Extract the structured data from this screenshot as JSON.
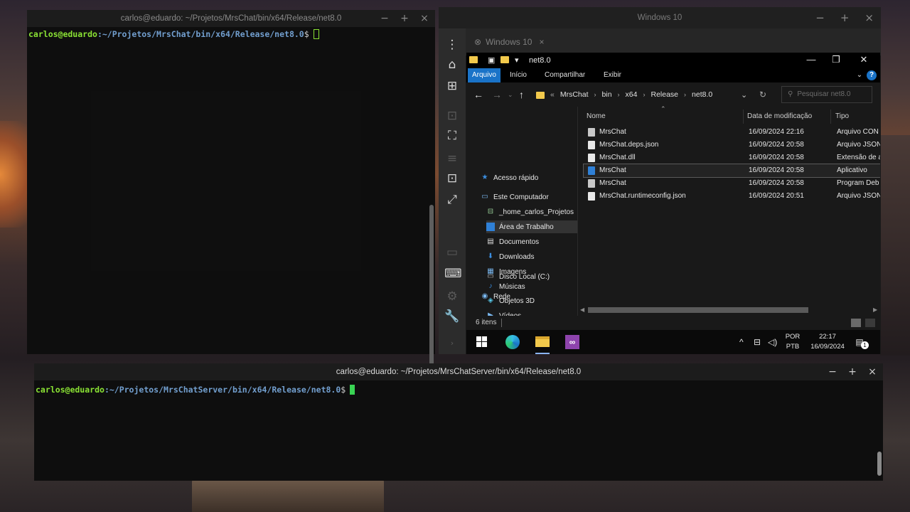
{
  "terminal_top": {
    "title": "carlos@eduardo: ~/Projetos/MrsChat/bin/x64/Release/net8.0",
    "prompt_user": "carlos@eduardo",
    "prompt_path": ":~/Projetos/MrsChat/bin/x64/Release/net8.0",
    "prompt_symbol": "$"
  },
  "terminal_bottom": {
    "title": "carlos@eduardo: ~/Projetos/MrsChatServer/bin/x64/Release/net8.0",
    "prompt_user": "carlos@eduardo",
    "prompt_path": ":~/Projetos/MrsChatServer/bin/x64/Release/net8.0",
    "prompt_symbol": "$"
  },
  "window_controls": {
    "minimize": "−",
    "maximize": "+",
    "close": "×"
  },
  "vm": {
    "title": "Windows 10",
    "tab_label": "Windows 10",
    "tab_close": "×",
    "controls": {
      "minimize": "−",
      "maximize": "+",
      "close": "×"
    }
  },
  "explorer": {
    "window_title": "net8.0",
    "controls": {
      "minimize": "—",
      "restore": "❐",
      "close": "✕"
    },
    "ribbon_tabs": [
      "Arquivo",
      "Início",
      "Compartilhar",
      "Exibir"
    ],
    "breadcrumb": [
      "MrsChat",
      "bin",
      "x64",
      "Release",
      "net8.0"
    ],
    "breadcrumb_prefix": "«",
    "search_placeholder": "Pesquisar net8.0",
    "nav": {
      "quick_access": "Acesso rápido",
      "this_pc": "Este Computador",
      "items": [
        "_home_carlos_Projetos",
        "Área de Trabalho",
        "Documentos",
        "Downloads",
        "Imagens",
        "Músicas",
        "Objetos 3D",
        "Vídeos",
        "Disco Local (C:)"
      ],
      "network": "Rede"
    },
    "columns": {
      "name": "Nome",
      "date": "Data de modificação",
      "type": "Tipo"
    },
    "files": [
      {
        "name": "MrsChat",
        "date": "16/09/2024 22:16",
        "type": "Arquivo CON"
      },
      {
        "name": "MrsChat.deps.json",
        "date": "16/09/2024 20:58",
        "type": "Arquivo JSON"
      },
      {
        "name": "MrsChat.dll",
        "date": "16/09/2024 20:58",
        "type": "Extensão de a"
      },
      {
        "name": "MrsChat",
        "date": "16/09/2024 20:58",
        "type": "Aplicativo"
      },
      {
        "name": "MrsChat",
        "date": "16/09/2024 20:58",
        "type": "Program Deb"
      },
      {
        "name": "MrsChat.runtimeconfig.json",
        "date": "16/09/2024 20:51",
        "type": "Arquivo JSON"
      }
    ],
    "status": "6 itens",
    "taskbar": {
      "lang_line1": "POR",
      "lang_line2": "PTB",
      "time": "22:17",
      "date": "16/09/2024",
      "notification_count": "1"
    }
  }
}
